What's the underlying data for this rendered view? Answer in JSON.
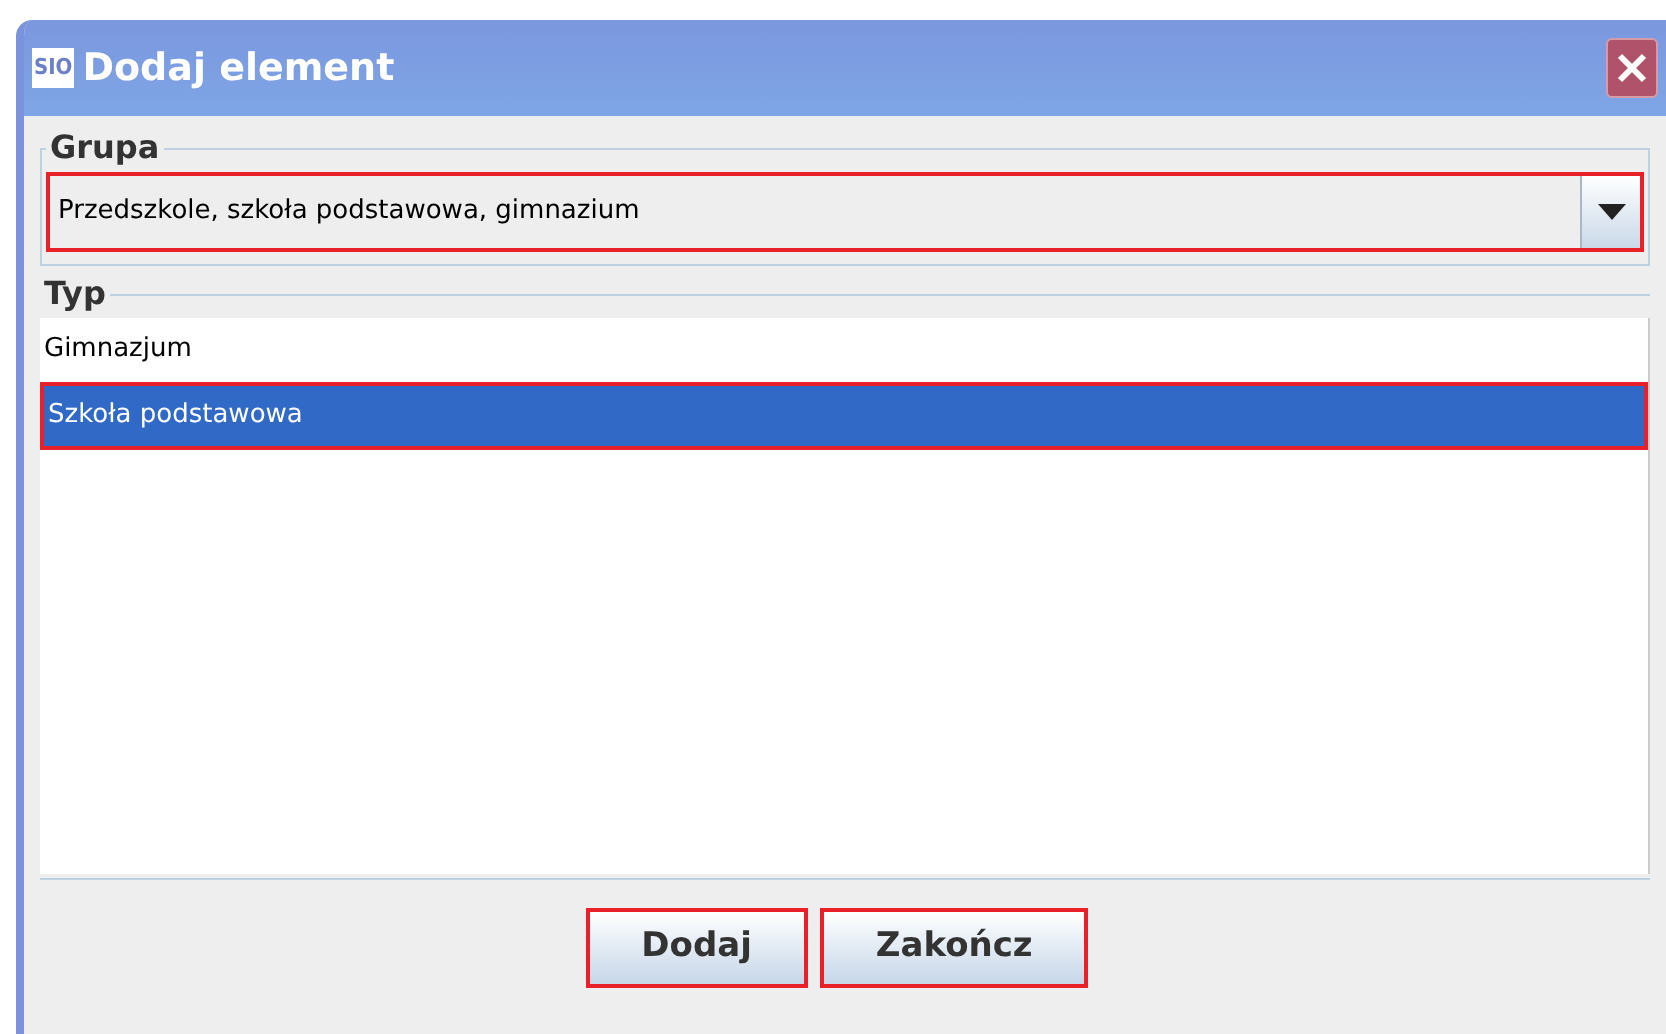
{
  "window": {
    "title": "Dodaj element",
    "logo": "SIO"
  },
  "grupa": {
    "legend": "Grupa",
    "value": "Przedszkole, szkoła podstawowa, gimnazium"
  },
  "typ": {
    "legend": "Typ",
    "items": [
      {
        "label": "Gimnazjum",
        "selected": false
      },
      {
        "label": "Szkoła podstawowa",
        "selected": true
      }
    ]
  },
  "buttons": [
    "Dodaj",
    "Zakończ"
  ]
}
